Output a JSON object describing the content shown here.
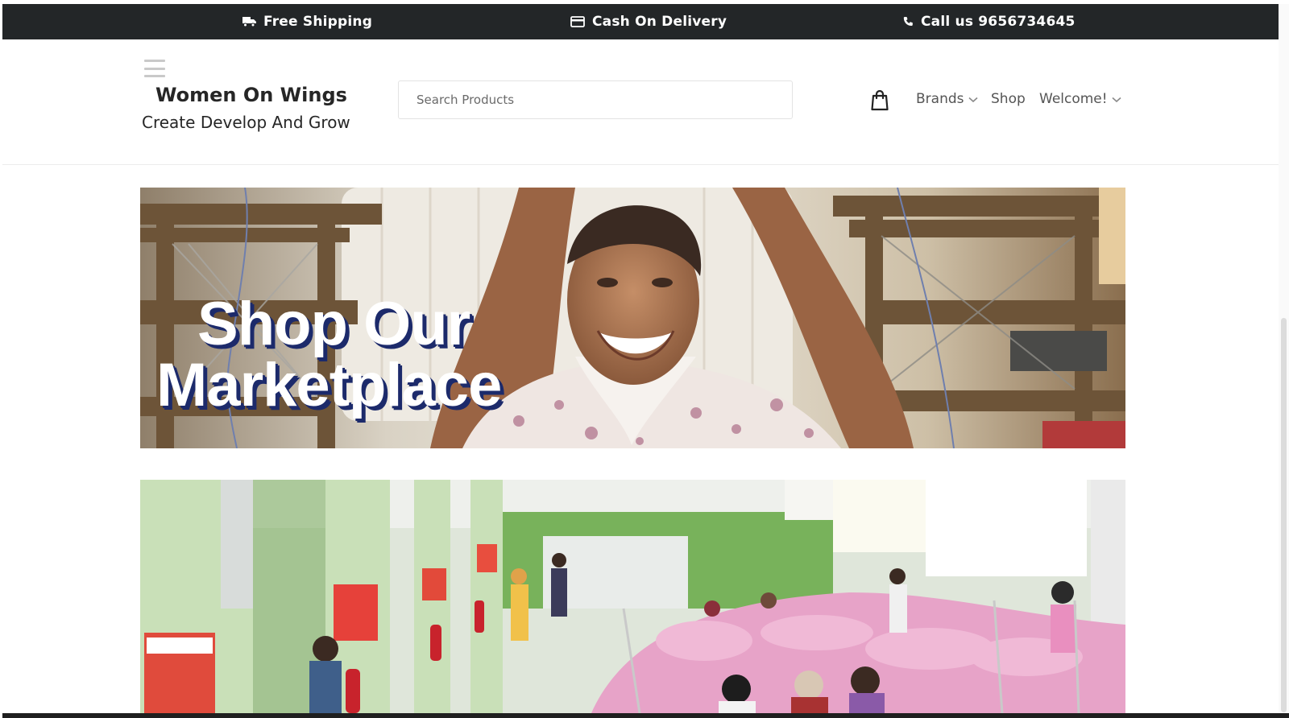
{
  "topbar": {
    "items": [
      {
        "icon": "truck-icon",
        "label": "Free Shipping"
      },
      {
        "icon": "credit-card-icon",
        "label": "Cash On Delivery"
      },
      {
        "icon": "phone-icon",
        "label": "Call us 9656734645"
      }
    ]
  },
  "header": {
    "brand_name": "Women On Wings",
    "tagline": "Create Develop And Grow",
    "search": {
      "placeholder": "Search Products",
      "value": ""
    },
    "nav": {
      "brands": "Brands",
      "shop": "Shop",
      "welcome": "Welcome!"
    }
  },
  "hero": {
    "heading_line1": "Shop Our",
    "heading_line2": "Marketplace"
  },
  "colors": {
    "topbar_bg": "#232628",
    "heading_shadow": "#1c2a6b",
    "text_dark": "#262626"
  }
}
